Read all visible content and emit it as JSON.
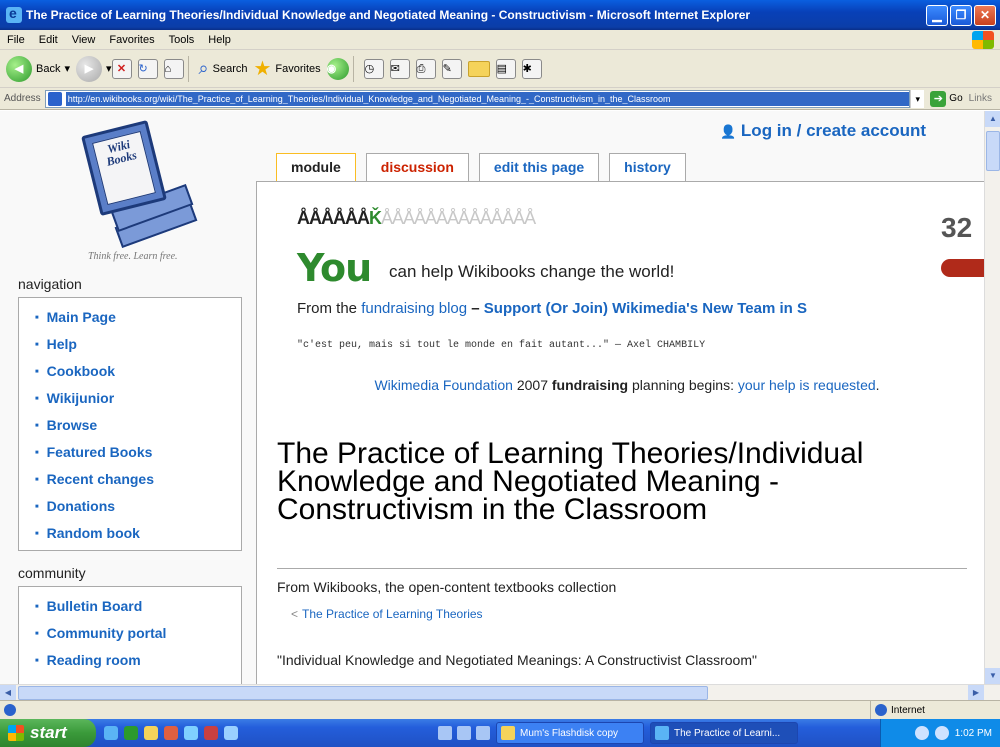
{
  "window": {
    "title": "The Practice of Learning Theories/Individual Knowledge and Negotiated Meaning - Constructivism - Microsoft Internet Explorer"
  },
  "menu": [
    "File",
    "Edit",
    "View",
    "Favorites",
    "Tools",
    "Help"
  ],
  "toolbar": {
    "back_label": "Back",
    "search_label": "Search",
    "favorites_label": "Favorites"
  },
  "address": {
    "label": "Address",
    "url": "http://en.wikibooks.org/wiki/The_Practice_of_Learning_Theories/Individual_Knowledge_and_Negotiated_Meaning_-_Constructivism_in_the_Classroom",
    "go_label": "Go",
    "links_label": "Links"
  },
  "wiki": {
    "login_label": "Log in / create account",
    "logo_text": "Wiki Books",
    "tagline": "Think free. Learn free.",
    "navigation": {
      "heading": "navigation",
      "items": [
        "Main Page",
        "Help",
        "Cookbook",
        "Wikijunior",
        "Browse",
        "Featured Books",
        "Recent changes",
        "Donations",
        "Random book"
      ]
    },
    "community": {
      "heading": "community",
      "items": [
        "Bulletin Board",
        "Community portal",
        "Reading room"
      ]
    },
    "tabs": [
      "module",
      "discussion",
      "edit this page",
      "history"
    ],
    "banner": {
      "counter": "32",
      "you": "You",
      "you_rest": "can help Wikibooks change the world!",
      "from_prefix": "From the",
      "blog_link": "fundraising blog",
      "dash": "–",
      "support_link": "Support (Or Join) Wikimedia's New Team in S",
      "quote": "\"c'est peu, mais si tout le monde en fait autant...\" — Axel CHAMBILY",
      "planning": {
        "foundation_link": "Wikimedia Foundation",
        "year": "2007",
        "bold": "fundraising",
        "text": "planning begins:",
        "help_link": "your help is requested",
        "period": "."
      }
    },
    "page_title": "The Practice of Learning Theories/Individual Knowledge and Negotiated Meaning - Constructivism in the Classroom",
    "site_sub": "From Wikibooks, the open-content textbooks collection",
    "breadcrumb": "The Practice of Learning Theories",
    "lead": "\"Individual Knowledge and Negotiated Meanings: A Constructivist Classroom\""
  },
  "statusbar": {
    "zone": "Internet"
  },
  "taskbar": {
    "start_label": "start",
    "tasks": [
      "Mum's Flashdisk copy",
      "The Practice of Learni..."
    ],
    "clock": "1:02 PM"
  }
}
